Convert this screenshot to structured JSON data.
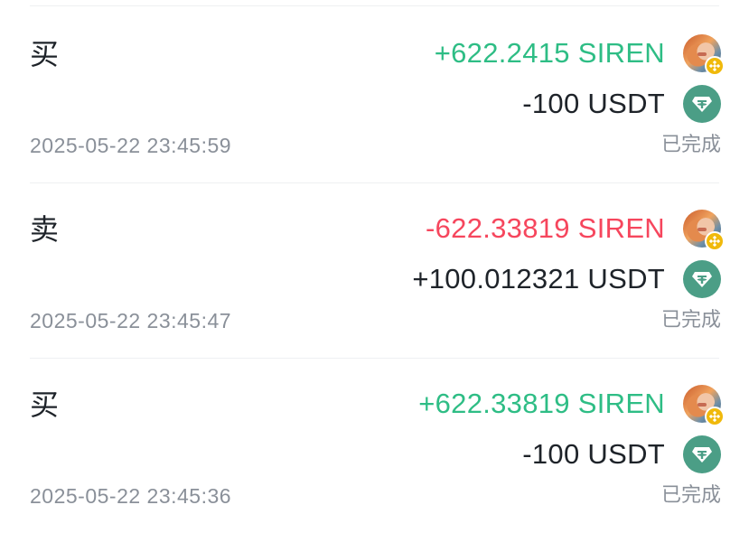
{
  "transactions": [
    {
      "side": "买",
      "base": {
        "amount": "+622.2415 SIREN",
        "direction": "positive",
        "icon": "siren-token-icon"
      },
      "quote": {
        "amount": "-100 USDT",
        "icon": "usdt-icon"
      },
      "time": "2025-05-22 23:45:59",
      "status": "已完成"
    },
    {
      "side": "卖",
      "base": {
        "amount": "-622.33819 SIREN",
        "direction": "negative",
        "icon": "siren-token-icon"
      },
      "quote": {
        "amount": "+100.012321 USDT",
        "icon": "usdt-icon"
      },
      "time": "2025-05-22 23:45:47",
      "status": "已完成"
    },
    {
      "side": "买",
      "base": {
        "amount": "+622.33819 SIREN",
        "direction": "positive",
        "icon": "siren-token-icon"
      },
      "quote": {
        "amount": "-100 USDT",
        "icon": "usdt-icon"
      },
      "time": "2025-05-22 23:45:36",
      "status": "已完成"
    }
  ],
  "colors": {
    "positive": "#2ebd85",
    "negative": "#f6465d",
    "text": "#1e2329",
    "muted": "#8a9099",
    "divider": "#eef0f2",
    "usdt": "#4b9e86",
    "bnb": "#f0b90b"
  }
}
